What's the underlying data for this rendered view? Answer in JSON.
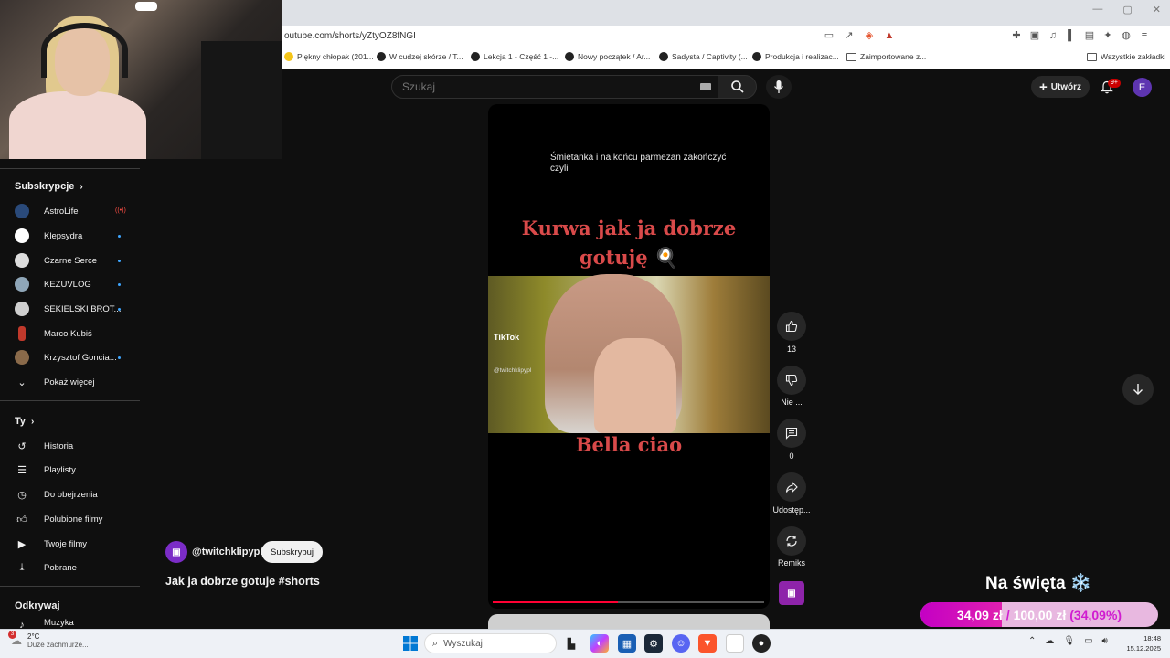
{
  "browser": {
    "url": "outube.com/shorts/yZtyOZ8fNGI",
    "bookmarks": [
      "Piękny chłopak (201...",
      "W cudzej skórze / T...",
      "Lekcja 1 - Część 1 -...",
      "Nowy początek / Ar...",
      "Sadysta / Captivity (...",
      "Produkcja i realizac...",
      "Zaimportowane z..."
    ],
    "all_bookmarks": "Wszystkie zakładki"
  },
  "header": {
    "search_placeholder": "Szukaj",
    "create_label": "Utwórz",
    "notif_count": "9+",
    "avatar_letter": "E"
  },
  "sidebar": {
    "subscriptions_title": "Subskrypcje",
    "subscriptions": [
      {
        "name": "AstroLife",
        "status": "live"
      },
      {
        "name": "Klepsydra",
        "status": "new"
      },
      {
        "name": "Czarne Serce",
        "status": "new"
      },
      {
        "name": "KEZUVLOG",
        "status": "new"
      },
      {
        "name": "SEKIELSKI BROT...",
        "status": "new"
      },
      {
        "name": "Marco Kubiś",
        "status": ""
      },
      {
        "name": "Krzysztof Goncia...",
        "status": "new"
      }
    ],
    "show_more": "Pokaż więcej",
    "you_title": "Ty",
    "you_items": [
      "Historia",
      "Playlisty",
      "Do obejrzenia",
      "Polubione filmy",
      "Twoje filmy",
      "Pobrane"
    ],
    "explore_title": "Odkrywaj",
    "explore_items": [
      "Muzyka"
    ]
  },
  "short": {
    "caption_top": "Śmietanka i na końcu parmezan zakończyć czyli",
    "big_title_line1": "Kurwa jak ja dobrze",
    "big_title_line2": "gotuję 🍳",
    "tiktok_logo": "TikTok",
    "tiktok_user": "@twitchklipypl",
    "bottom_caption": "Bella ciao",
    "progress": 0.46
  },
  "actions": {
    "likes": "13",
    "dislike_label": "Nie ...",
    "comments": "0",
    "share_label": "Udostęp...",
    "remix_label": "Remiks"
  },
  "channel": {
    "handle": "@twitchklipypl",
    "subscribe_label": "Subskrybuj",
    "video_title": "Jak ja dobrze gotuje #shorts"
  },
  "overlay": {
    "title": "Na święta ❄️",
    "current": "34,09 zł",
    "separator": "/",
    "goal": "100,00 zł",
    "percent": "(34,09%)",
    "progress": 0.3409
  },
  "taskbar": {
    "temperature": "2°C",
    "weather_desc": "Duże zachmurze...",
    "weather_badge": "3",
    "search_placeholder": "Wyszukaj",
    "time": "18:48",
    "date": "15.12.2025"
  },
  "colors": {
    "accent_red": "#ff0033",
    "overlay_magenta": "#c400c4",
    "title_red": "#d94a4a"
  }
}
